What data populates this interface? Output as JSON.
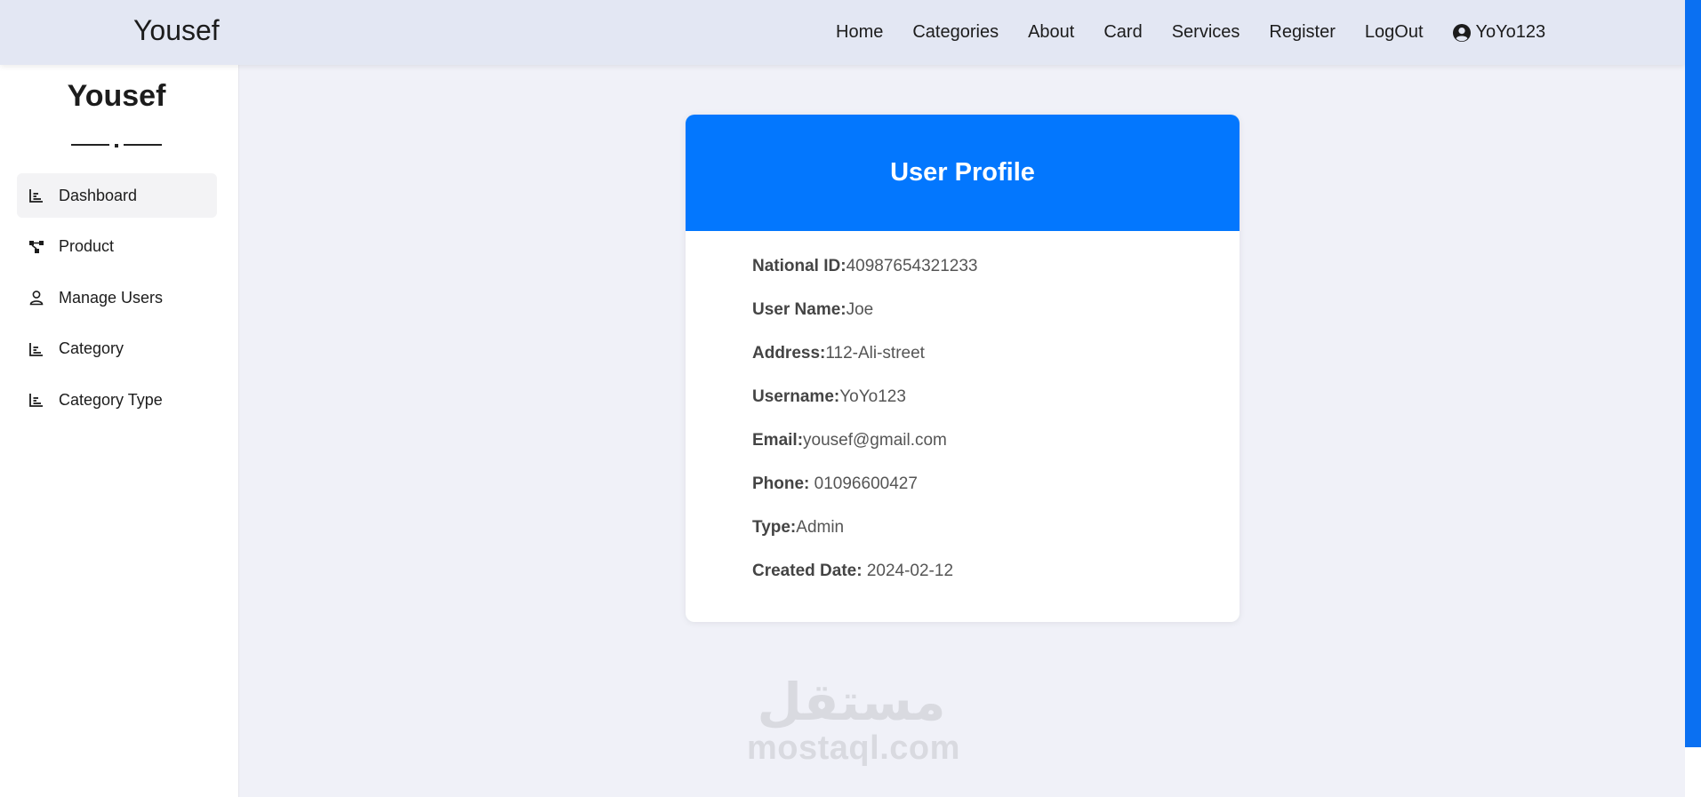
{
  "topbar": {
    "brand": "Yousef",
    "nav": [
      "Home",
      "Categories",
      "About",
      "Card",
      "Services",
      "Register",
      "LogOut"
    ],
    "user": {
      "icon": "user-circle-icon",
      "name": "YoYo123"
    }
  },
  "sidebar": {
    "brand": "Yousef",
    "items": [
      {
        "label": "Dashboard",
        "icon": "bar-chart-icon",
        "active": true
      },
      {
        "label": "Product",
        "icon": "nodes-icon",
        "active": false
      },
      {
        "label": "Manage Users",
        "icon": "user-icon",
        "active": false
      },
      {
        "label": "Category",
        "icon": "bar-chart-icon",
        "active": false
      },
      {
        "label": "Category Type",
        "icon": "bar-chart-icon",
        "active": false
      }
    ]
  },
  "profile": {
    "title": "User Profile",
    "fields": [
      {
        "label": "National ID:",
        "value": "40987654321233"
      },
      {
        "label": "User Name:",
        "value": "Joe"
      },
      {
        "label": "Address:",
        "value": "112-Ali-street"
      },
      {
        "label": "Username:",
        "value": "YoYo123"
      },
      {
        "label": "Email:",
        "value": "yousef@gmail.com"
      },
      {
        "label": "Phone:",
        "value": " 01096600427"
      },
      {
        "label": "Type:",
        "value": "Admin"
      },
      {
        "label": "Created Date:",
        "value": " 2024-02-12"
      }
    ]
  },
  "watermark": {
    "arabic": "مستقل",
    "latin": "mostaql.com"
  },
  "colors": {
    "accent": "#0377fe",
    "topbar_bg": "#e3e7f3",
    "page_bg": "#f0f1f8",
    "scrollbar": "#0a70f2"
  }
}
